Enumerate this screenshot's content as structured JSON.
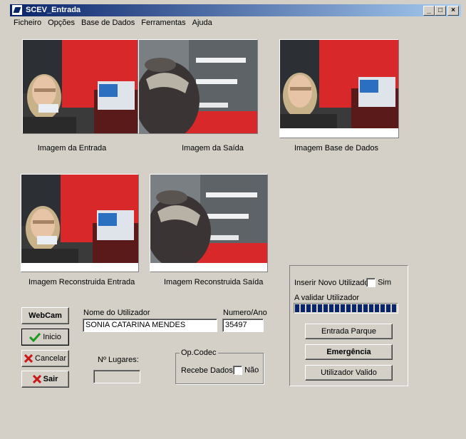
{
  "window": {
    "title": "SCEV_Entrada",
    "minimize_label": "_",
    "maximize_label": "□",
    "close_label": "×"
  },
  "menu": [
    "Ficheiro",
    "Opções",
    "Base de Dados",
    "Ferramentas",
    "Ajuda"
  ],
  "images": {
    "entrada": "Imagem da Entrada",
    "saida": "Imagem da Saída",
    "base_dados": "Imagem Base de Dados",
    "reconstruida_entrada": "Imagem Reconstruida Entrada",
    "reconstruida_saida": "Imagem Reconstruida Saída"
  },
  "buttons": {
    "webcam": "WebCam",
    "inicio": "Inicio",
    "cancelar": "Cancelar",
    "sair": "Sair",
    "entrada_parque": "Entrada Parque",
    "emergencia": "Emergência",
    "utilizador_valido": "Utilizador Valido"
  },
  "form": {
    "nome_label": "Nome do Utilizador",
    "nome_value": "SONIA CATARINA MENDES",
    "numero_label": "Numero/Ano",
    "numero_value": "35497",
    "lugares_label": "Nº Lugares:",
    "lugares_value": ""
  },
  "opcodec": {
    "title": "Op.Codec",
    "recebe_label": "Recebe Dados",
    "nao_label": "Não",
    "nao_checked": false
  },
  "validacao": {
    "inserir_label": "Inserir Novo Utilizador",
    "sim_label": "Sim",
    "sim_checked": false,
    "validar_label": "A validar Utilizador",
    "progress_fraction": 1.0
  },
  "colors": {
    "titlebar": "#0a246a",
    "progress": "#0a246a",
    "face": "#d4d0c8",
    "check_green": "#1a9a1a",
    "cross_red": "#c81818"
  }
}
